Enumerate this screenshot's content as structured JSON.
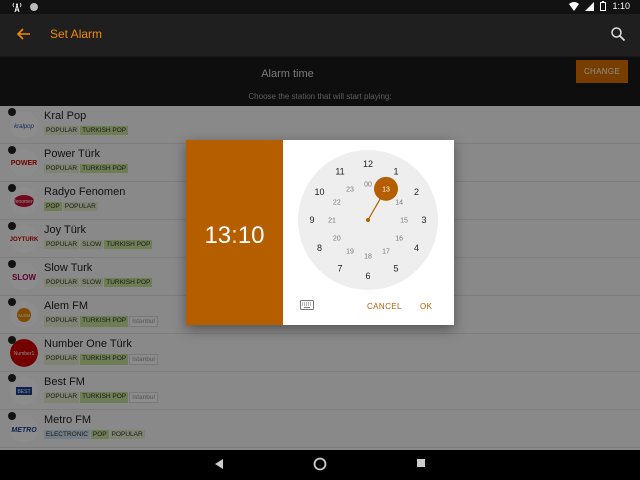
{
  "status": {
    "time": "1:10"
  },
  "appbar": {
    "title": "Set Alarm"
  },
  "alarm": {
    "label": "Alarm time",
    "change_label": "CHANGE",
    "hint": "Choose the station that will start playing:"
  },
  "stations": [
    {
      "name": "Kral Pop",
      "tags": [
        "POPULAR",
        "TURKISH POP"
      ]
    },
    {
      "name": "Power Türk",
      "tags": [
        "POPULAR",
        "TURKISH POP"
      ]
    },
    {
      "name": "Radyo Fenomen",
      "tags": [
        "POP",
        "POPULAR"
      ]
    },
    {
      "name": "Joy Türk",
      "tags": [
        "POPULAR",
        "SLOW",
        "TURKISH POP"
      ]
    },
    {
      "name": "Slow Turk",
      "tags": [
        "POPULAR",
        "SLOW",
        "TURKISH POP"
      ]
    },
    {
      "name": "Alem FM",
      "tags": [
        "POPULAR",
        "TURKISH POP",
        "Istanbul"
      ]
    },
    {
      "name": "Number One Türk",
      "tags": [
        "POPULAR",
        "TURKISH POP",
        "Istanbul"
      ]
    },
    {
      "name": "Best FM",
      "tags": [
        "POPULAR",
        "TURKISH POP",
        "Istanbul"
      ]
    },
    {
      "name": "Metro FM",
      "tags": [
        "ELECTRONIC",
        "POP",
        "POPULAR"
      ]
    }
  ],
  "dialog": {
    "hours": "13",
    "minutes": "10",
    "cancel_label": "CANCEL",
    "ok_label": "OK",
    "clock_outer": [
      "12",
      "1",
      "2",
      "3",
      "4",
      "5",
      "6",
      "7",
      "8",
      "9",
      "10",
      "11"
    ],
    "clock_inner": [
      "00",
      "13",
      "14",
      "15",
      "16",
      "17",
      "18",
      "19",
      "20",
      "21",
      "22",
      "23"
    ],
    "selected": "13"
  },
  "colors": {
    "accent": "#b55e00",
    "appbar_title": "#f08a00"
  }
}
